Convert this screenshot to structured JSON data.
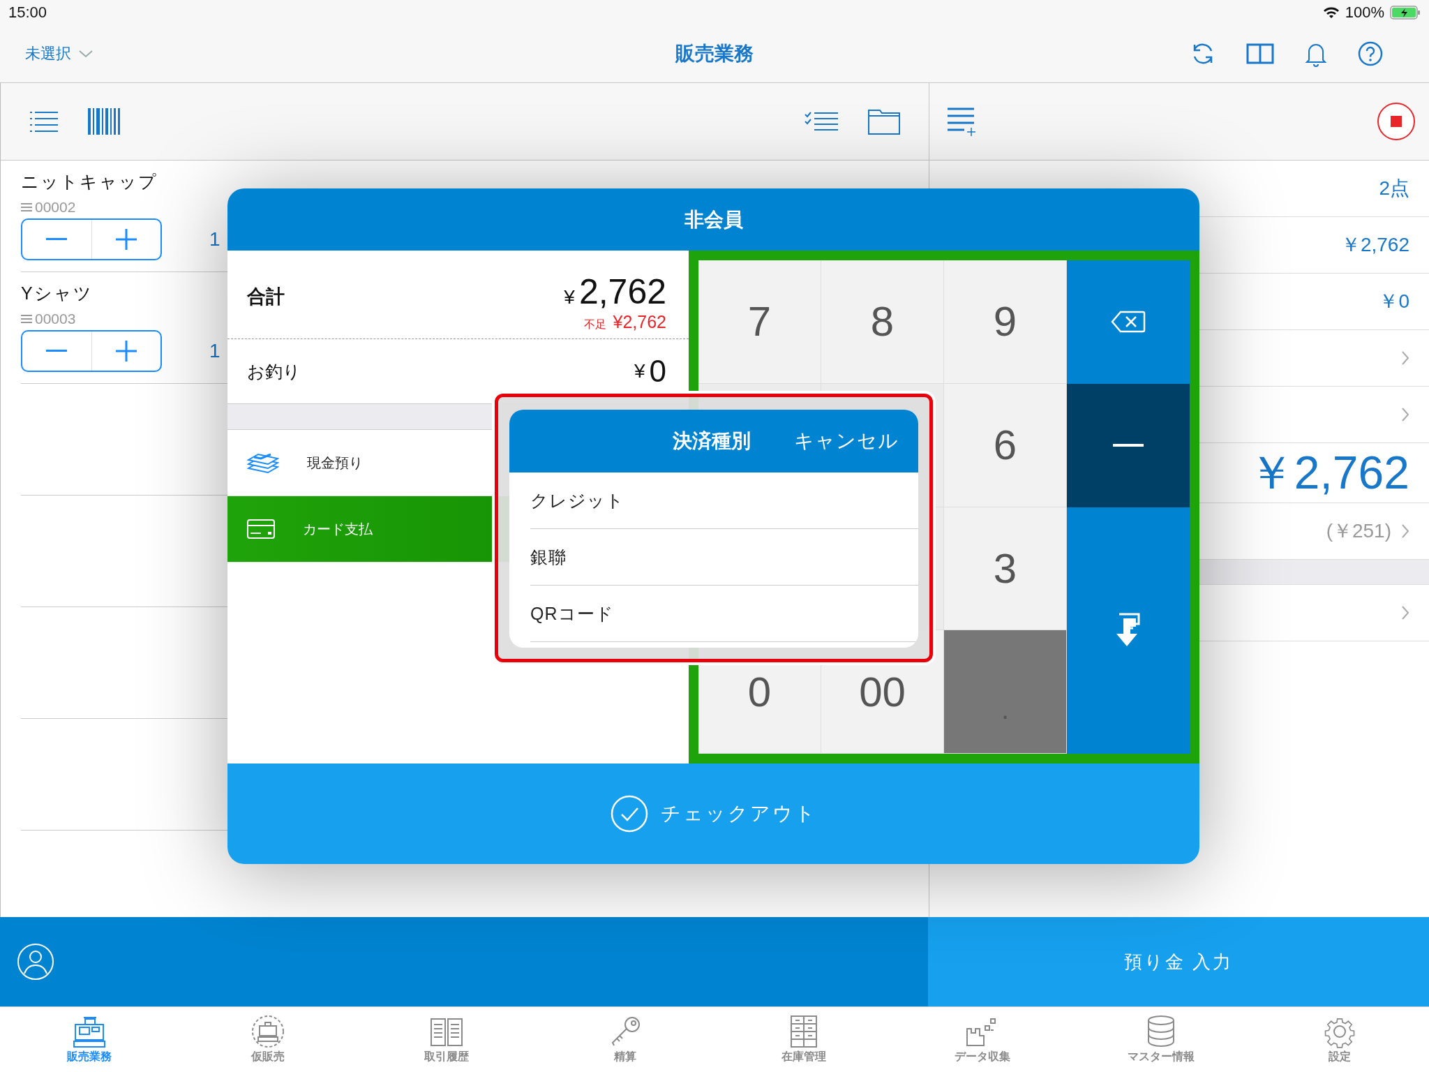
{
  "status_bar": {
    "time": "15:00",
    "battery": "100%"
  },
  "nav": {
    "selector": "未選択",
    "title": "販売業務"
  },
  "items": [
    {
      "name": "ニットキャップ",
      "code": "00002",
      "quantity": "1"
    },
    {
      "name": "Yシャツ",
      "code": "00003",
      "quantity": "1"
    }
  ],
  "summary_rows": [
    {
      "kind": "value",
      "value": "2点"
    },
    {
      "kind": "value",
      "value": "￥2,762"
    },
    {
      "kind": "value",
      "value": "￥0"
    },
    {
      "kind": "link"
    },
    {
      "kind": "link"
    },
    {
      "kind": "total",
      "value": "￥2,762"
    },
    {
      "kind": "link",
      "value": "(￥251)"
    },
    {
      "kind": "gap"
    },
    {
      "kind": "link"
    }
  ],
  "modal": {
    "title": "非会員",
    "total_label": "合計",
    "currency": "¥",
    "total": "2,762",
    "shortage_label": "不足",
    "shortage": "¥2,762",
    "change_label": "お釣り",
    "change_currency": "¥",
    "change": "0",
    "methods": [
      {
        "kind": "cash",
        "label": "現金預り",
        "selected": false
      },
      {
        "kind": "card",
        "label": "カード支払",
        "selected": true
      }
    ],
    "keys": [
      {
        "kind": "digit",
        "label": "7"
      },
      {
        "kind": "digit",
        "label": "8"
      },
      {
        "kind": "digit",
        "label": "9"
      },
      {
        "kind": "backspace"
      },
      {
        "kind": "hidden"
      },
      {
        "kind": "hidden"
      },
      {
        "kind": "digit",
        "label": "6"
      },
      {
        "kind": "minus"
      },
      {
        "kind": "covered"
      },
      {
        "kind": "hidden"
      },
      {
        "kind": "digit",
        "label": "3"
      },
      {
        "kind": "enter"
      },
      {
        "kind": "digit",
        "label": "0"
      },
      {
        "kind": "digit",
        "label": "00"
      },
      {
        "kind": "dot",
        "label": "."
      }
    ],
    "checkout": "チェックアウト"
  },
  "popover": {
    "title": "決済種別",
    "cancel": "キャンセル",
    "options": [
      "クレジット",
      "銀聯",
      "QRコード"
    ]
  },
  "deposit_button": "預り金 入力",
  "tabs": [
    {
      "kind": "register",
      "label": "販売業務",
      "selected": true
    },
    {
      "kind": "pending",
      "label": "仮販売",
      "selected": false
    },
    {
      "kind": "history",
      "label": "取引履歴",
      "selected": false
    },
    {
      "kind": "settle",
      "label": "精算",
      "selected": false
    },
    {
      "kind": "stock",
      "label": "在庫管理",
      "selected": false
    },
    {
      "kind": "data",
      "label": "データ収集",
      "selected": false
    },
    {
      "kind": "master",
      "label": "マスター情報",
      "selected": false
    },
    {
      "kind": "settings",
      "label": "設定",
      "selected": false
    }
  ]
}
